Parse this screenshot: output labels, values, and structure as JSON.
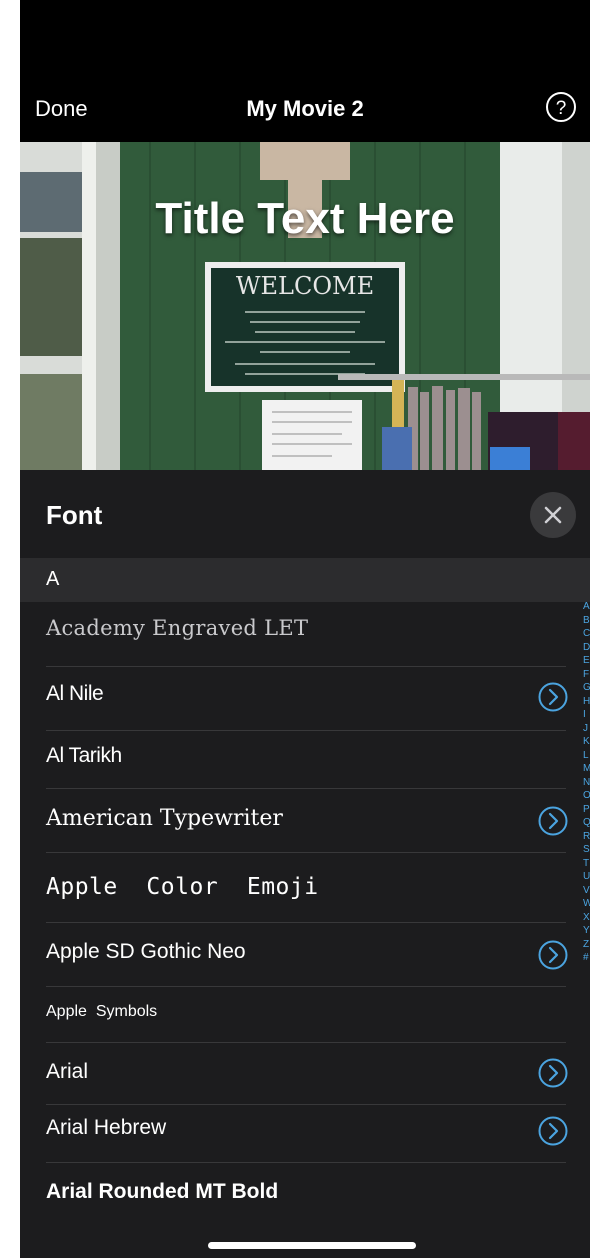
{
  "nav": {
    "done_label": "Done",
    "title": "My Movie 2",
    "help_label": "?"
  },
  "preview": {
    "title_text": "Title Text Here"
  },
  "panel": {
    "title": "Font",
    "section_header": "A",
    "fonts": [
      {
        "name": "Academy Engraved LET",
        "has_variants": false
      },
      {
        "name": "Al Nile",
        "has_variants": true
      },
      {
        "name": "Al Tarikh",
        "has_variants": false
      },
      {
        "name": "American Typewriter",
        "has_variants": true
      },
      {
        "name": "Apple  Color  Emoji",
        "has_variants": false
      },
      {
        "name": "Apple SD Gothic Neo",
        "has_variants": true
      },
      {
        "name": "Apple  Symbols",
        "has_variants": false
      },
      {
        "name": "Arial",
        "has_variants": true
      },
      {
        "name": "Arial Hebrew",
        "has_variants": true
      },
      {
        "name": "Arial Rounded MT Bold",
        "has_variants": false
      }
    ],
    "index_letters": [
      "A",
      "B",
      "C",
      "D",
      "E",
      "F",
      "G",
      "H",
      "I",
      "J",
      "K",
      "L",
      "M",
      "N",
      "O",
      "P",
      "Q",
      "R",
      "S",
      "T",
      "U",
      "V",
      "W",
      "X",
      "Y",
      "Z",
      "#"
    ]
  },
  "colors": {
    "accent": "#4ba4e0",
    "panel_bg": "#1c1c1e",
    "section_bg": "#2c2c2e"
  }
}
